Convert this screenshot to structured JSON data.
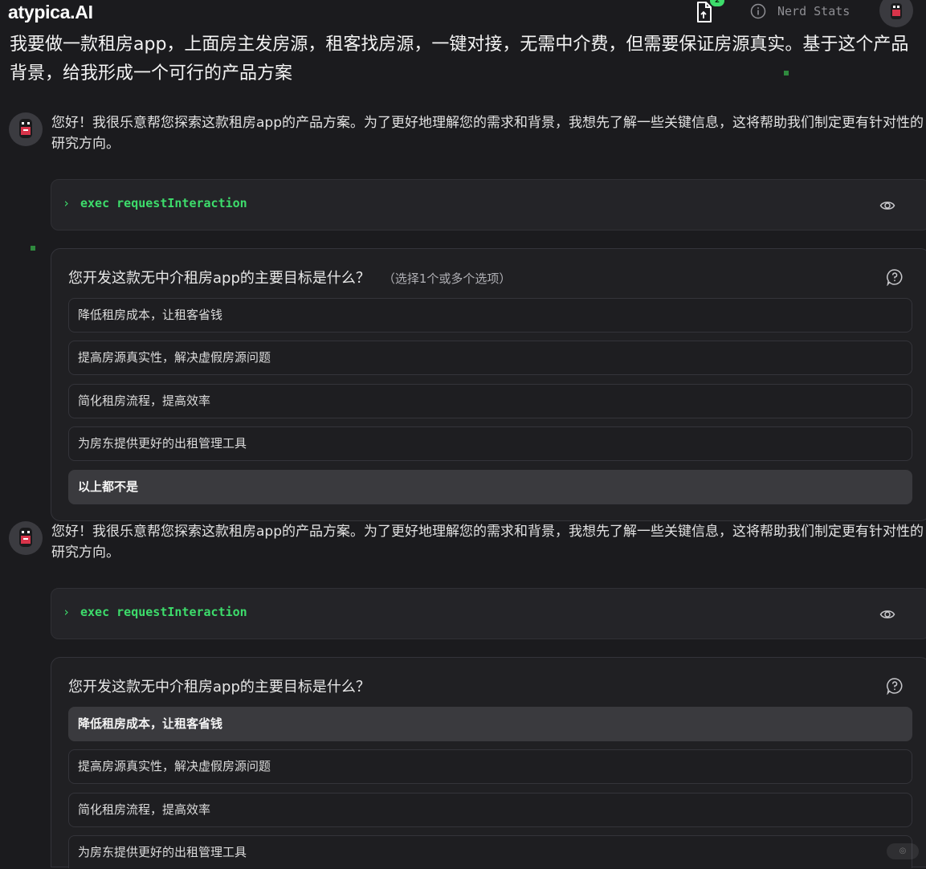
{
  "app": {
    "logo": "atypica.AI",
    "doc_badge": "2",
    "nerd_stats": "Nerd Stats"
  },
  "user_message": "我要做一款租房app，上面房主发房源，租客找房源，一键对接，无需中介费，但需要保证房源真实。基于这个产品背景，给我形成一个可行的产品方案",
  "assistant_blocks": [
    {
      "text": "您好！我很乐意帮您探索这款租房app的产品方案。为了更好地理解您的需求和背景，我想先了解一些关键信息，这将帮助我们制定更有针对性的研究方向。",
      "exec": "exec requestInteraction",
      "question": "您开发这款无中介租房app的主要目标是什么？",
      "hint": "（选择1个或多个选项）",
      "options": [
        {
          "label": "降低租房成本，让租客省钱",
          "selected": false
        },
        {
          "label": "提高房源真实性，解决虚假房源问题",
          "selected": false
        },
        {
          "label": "简化租房流程，提高效率",
          "selected": false
        },
        {
          "label": "为房东提供更好的出租管理工具",
          "selected": false
        },
        {
          "label": "以上都不是",
          "selected": true
        }
      ]
    },
    {
      "text": "您好！我很乐意帮您探索这款租房app的产品方案。为了更好地理解您的需求和背景，我想先了解一些关键信息，这将帮助我们制定更有针对性的研究方向。",
      "exec": "exec requestInteraction",
      "question": "您开发这款无中介租房app的主要目标是什么？",
      "hint": "",
      "options": [
        {
          "label": "降低租房成本，让租客省钱",
          "selected": true
        },
        {
          "label": "提高房源真实性，解决虚假房源问题",
          "selected": false
        },
        {
          "label": "简化租房流程，提高效率",
          "selected": false
        },
        {
          "label": "为房东提供更好的出租管理工具",
          "selected": false
        }
      ]
    }
  ],
  "colors": {
    "background": "#1b1b1e",
    "accent_green": "#3ddc6b",
    "selected_option": "#3a3a3e"
  }
}
